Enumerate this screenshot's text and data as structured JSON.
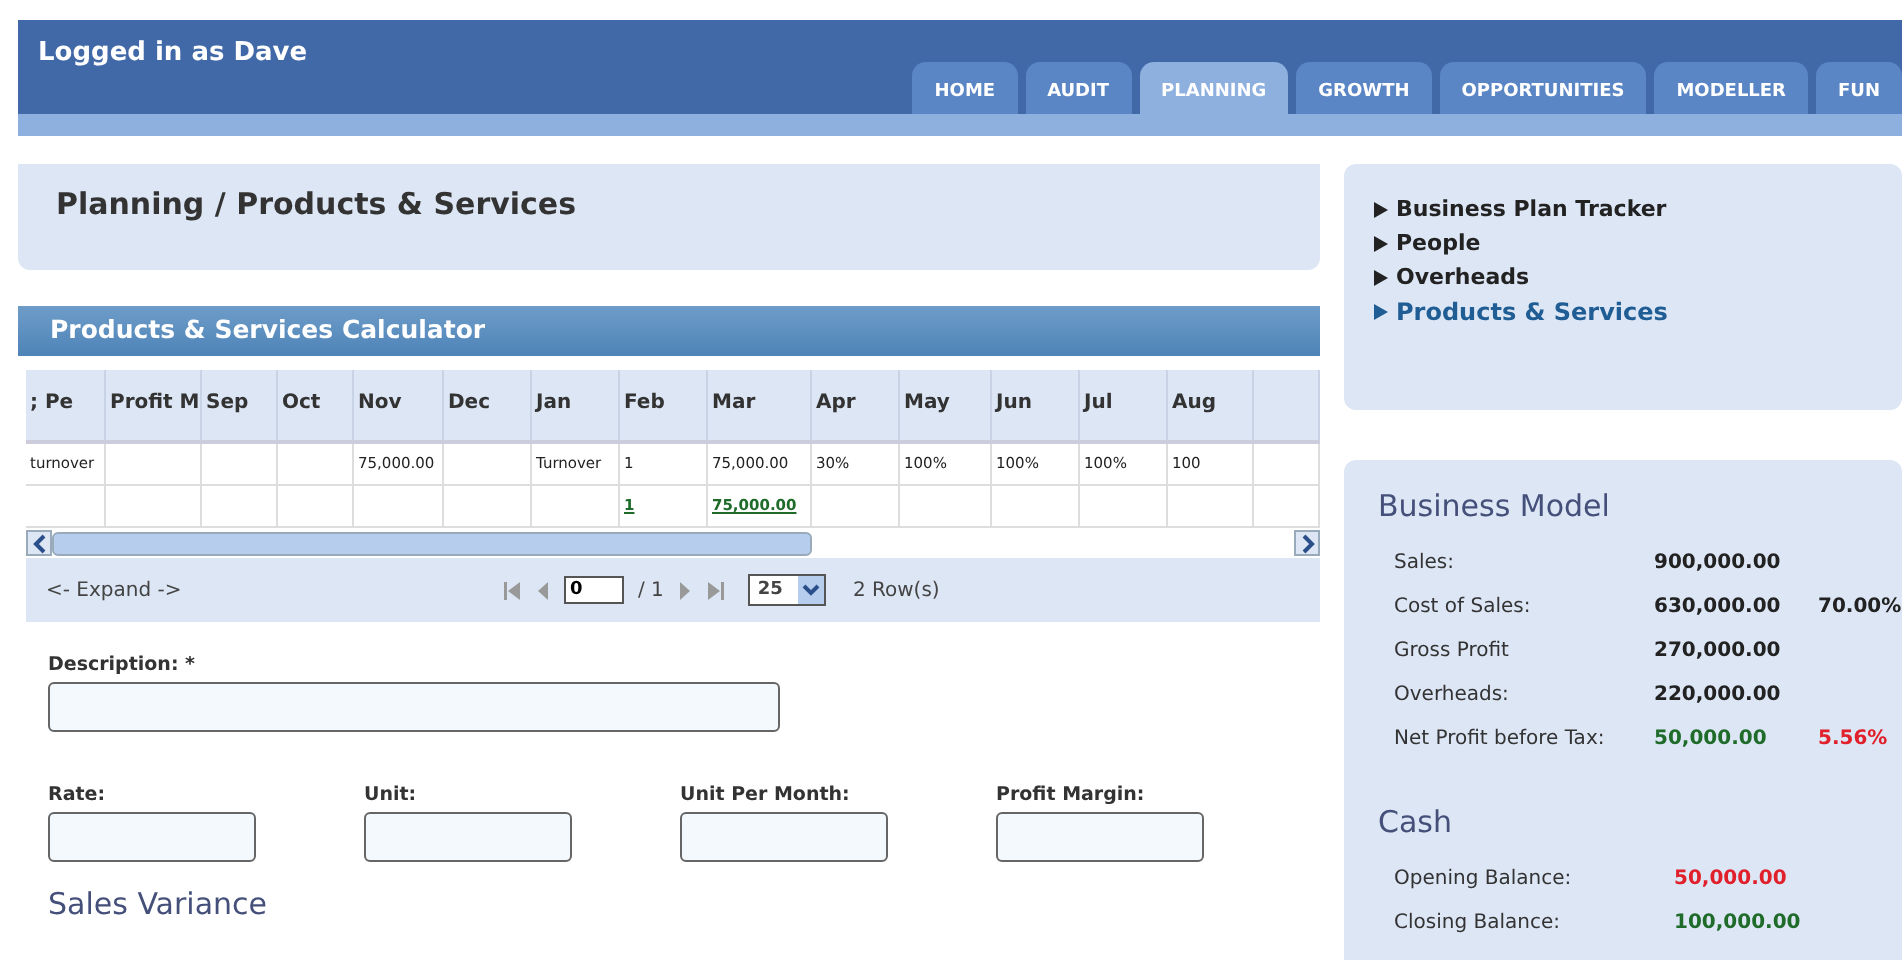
{
  "header": {
    "user": "Logged in as Dave"
  },
  "tabs": [
    {
      "label": "HOME",
      "selected": false
    },
    {
      "label": "AUDIT",
      "selected": false
    },
    {
      "label": "PLANNING",
      "selected": true
    },
    {
      "label": "GROWTH",
      "selected": false
    },
    {
      "label": "OPPORTUNITIES",
      "selected": false
    },
    {
      "label": "MODELLER",
      "selected": false
    },
    {
      "label": "FUN",
      "selected": false
    }
  ],
  "page_title": "Planning / Products & Services",
  "calculator": {
    "title": "Products & Services Calculator",
    "columns": [
      "; Pe",
      "Profit M",
      "Sep",
      "Oct",
      "Nov",
      "Dec",
      "Jan",
      "Feb",
      "Mar",
      "Apr",
      "May",
      "Jun",
      "Jul",
      "Aug",
      ""
    ],
    "rows": [
      {
        "cells": [
          {
            "text": "turnover",
            "link": false
          },
          {
            "text": ""
          },
          {
            "text": ""
          },
          {
            "text": ""
          },
          {
            "text": "75,000.00",
            "link": false
          },
          {
            "text": ""
          },
          {
            "text": "Turnover",
            "link": false
          },
          {
            "text": "1",
            "link": false
          },
          {
            "text": "75,000.00",
            "link": false
          },
          {
            "text": "30%",
            "link": false
          },
          {
            "text": "100%",
            "link": false
          },
          {
            "text": "100%",
            "link": false
          },
          {
            "text": "100%",
            "link": false
          },
          {
            "text": "100",
            "link": false
          },
          {
            "text": ""
          }
        ]
      },
      {
        "cells": [
          {
            "text": ""
          },
          {
            "text": ""
          },
          {
            "text": ""
          },
          {
            "text": ""
          },
          {
            "text": ""
          },
          {
            "text": ""
          },
          {
            "text": ""
          },
          {
            "text": "1",
            "link": true
          },
          {
            "text": "75,000.00",
            "link": true
          },
          {
            "text": ""
          },
          {
            "text": ""
          },
          {
            "text": ""
          },
          {
            "text": ""
          },
          {
            "text": ""
          },
          {
            "text": ""
          }
        ]
      }
    ],
    "pager": {
      "expand": "<- Expand ->",
      "page": "0",
      "of": "/ 1",
      "page_size": "25",
      "row_count": "2 Row(s)"
    }
  },
  "form": {
    "description_label": "Description: *",
    "fields": [
      "Rate:",
      "Unit:",
      "Unit Per Month:",
      "Profit Margin:"
    ]
  },
  "section": "Sales Variance",
  "side_nav": [
    {
      "label": "Business Plan Tracker",
      "selected": false
    },
    {
      "label": "People",
      "selected": false
    },
    {
      "label": "Overheads",
      "selected": false
    },
    {
      "label": "Products & Services",
      "selected": true
    }
  ],
  "business_model": {
    "title": "Business Model",
    "rows": [
      {
        "label": "Sales:",
        "value": "900,000.00",
        "color": "#222222"
      },
      {
        "label": "Cost of Sales:",
        "value": "630,000.00",
        "color": "#222222",
        "percent": {
          "text": "70.00%",
          "color": "#222222"
        }
      },
      {
        "label": "Gross Profit",
        "value": "270,000.00",
        "color": "#222222"
      },
      {
        "label": "Overheads:",
        "value": "220,000.00",
        "color": "#222222"
      },
      {
        "label": "Net Profit before Tax:",
        "value": "50,000.00",
        "color": "#1e6b2a",
        "percent": {
          "text": "5.56%",
          "color": "#e0202a"
        }
      }
    ]
  },
  "cash": {
    "title": "Cash",
    "rows": [
      {
        "label": "Opening Balance:",
        "value": "50,000.00",
        "color": "#e0202a"
      },
      {
        "label": "Closing Balance:",
        "value": "100,000.00",
        "color": "#1e6b2a"
      }
    ]
  }
}
